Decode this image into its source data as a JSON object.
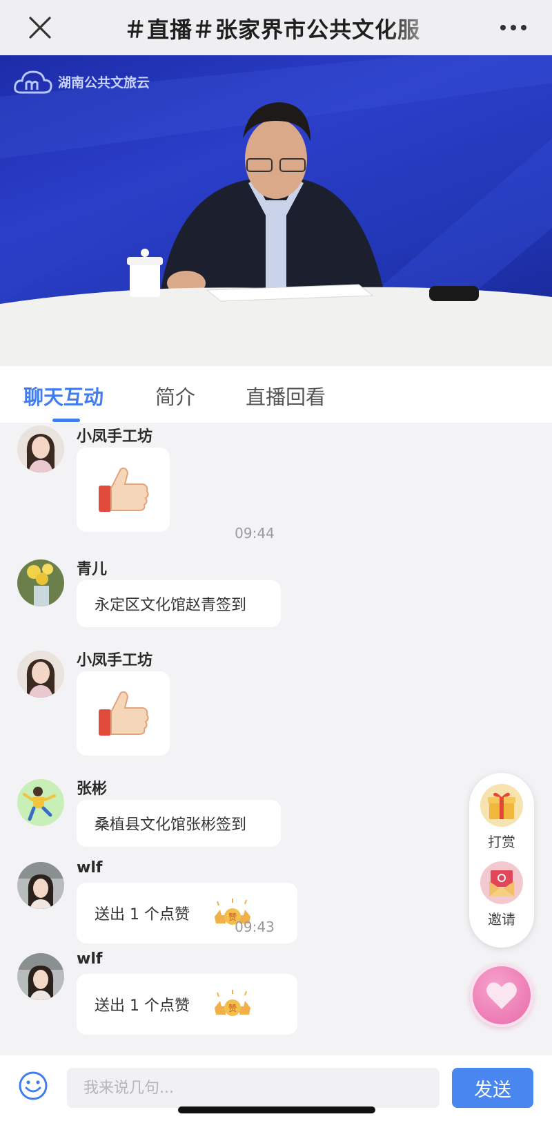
{
  "header": {
    "title": "＃直播＃张家界市公共文化服",
    "close_icon": "close-icon",
    "more_icon": "more-dots-icon"
  },
  "video": {
    "logo_text": "湖南公共文旅云"
  },
  "tabs": [
    {
      "label": "聊天互动",
      "active": true
    },
    {
      "label": "简介",
      "active": false
    },
    {
      "label": "直播回看",
      "active": false
    }
  ],
  "chat": {
    "messages": [
      {
        "name": "小凤手工坊",
        "type": "thumbs-up"
      },
      {
        "time": "09:44"
      },
      {
        "name": "青儿",
        "text": "永定区文化馆赵青签到"
      },
      {
        "name": "小凤手工坊",
        "type": "thumbs-up"
      },
      {
        "name": "张彬",
        "text": "桑植县文化馆张彬签到"
      },
      {
        "name": "wlf",
        "text": "送出 1 个点赞",
        "sticker": "like-sticker"
      },
      {
        "time": "09:43"
      },
      {
        "name": "wlf",
        "text": "送出 1 个点赞",
        "sticker": "like-sticker"
      }
    ]
  },
  "float_panel": {
    "reward_label": "打赏",
    "invite_label": "邀请"
  },
  "input": {
    "placeholder": "我来说几句...",
    "send_label": "发送"
  },
  "colors": {
    "accent": "#3f7df0",
    "send_button": "#4a86f0",
    "like_button": "#e86aa9"
  }
}
